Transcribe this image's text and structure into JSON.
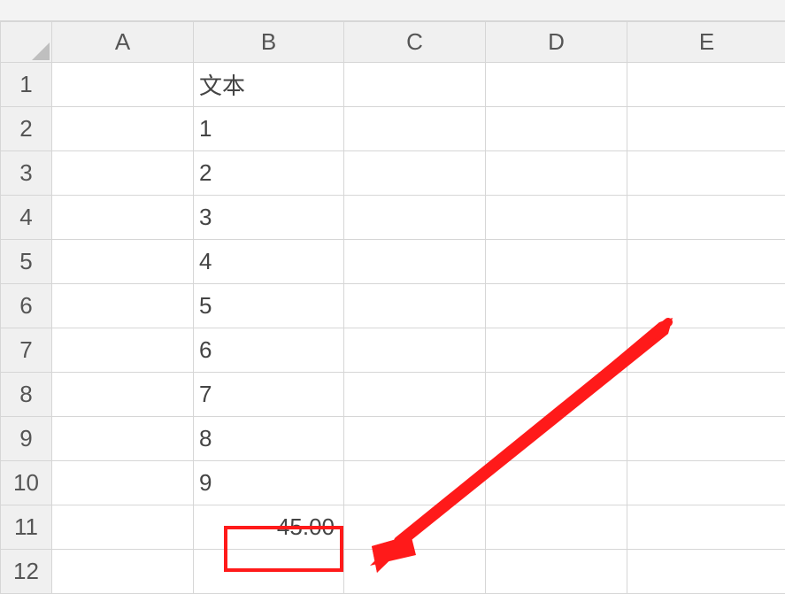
{
  "columns": [
    "A",
    "B",
    "C",
    "D",
    "E"
  ],
  "row_count": 12,
  "cells": {
    "B1": "文本",
    "B2": "1",
    "B3": "2",
    "B4": "3",
    "B5": "4",
    "B6": "5",
    "B7": "6",
    "B8": "7",
    "B9": "8",
    "B10": "9",
    "B11": "45.00"
  },
  "highlight_cell": "B11",
  "annotation": {
    "type": "arrow",
    "color": "#ff1a1a",
    "points_to": "B11"
  }
}
